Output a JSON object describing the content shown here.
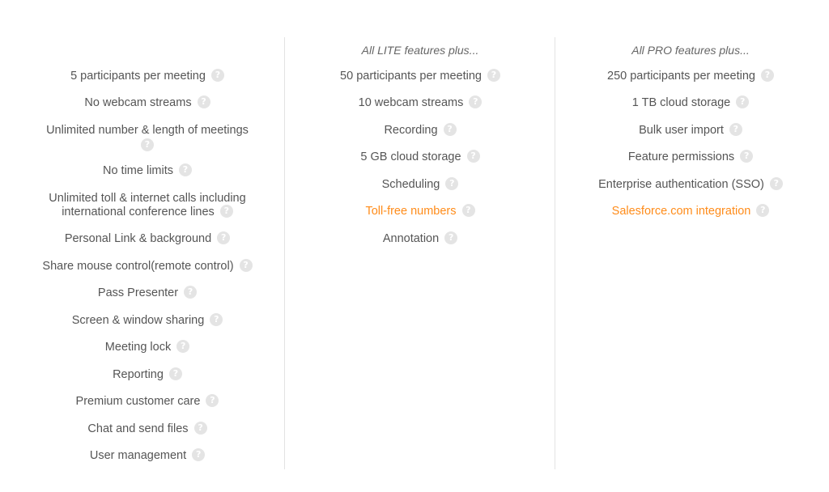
{
  "help_glyph": "?",
  "columns": [
    {
      "header": "",
      "features": [
        {
          "label": "5 participants per meeting"
        },
        {
          "label": "No webcam streams"
        },
        {
          "label": "Unlimited number & length of meetings"
        },
        {
          "label": "No time limits"
        },
        {
          "label": "Unlimited toll & internet calls including international conference lines"
        },
        {
          "label": "Personal Link & background"
        },
        {
          "label": "Share mouse control(remote control)"
        },
        {
          "label": "Pass Presenter"
        },
        {
          "label": "Screen & window sharing"
        },
        {
          "label": "Meeting lock"
        },
        {
          "label": "Reporting"
        },
        {
          "label": "Premium customer care"
        },
        {
          "label": "Chat and send files"
        },
        {
          "label": "User management"
        }
      ]
    },
    {
      "header": "All LITE features plus...",
      "features": [
        {
          "label": "50 participants per meeting"
        },
        {
          "label": "10 webcam streams"
        },
        {
          "label": "Recording"
        },
        {
          "label": "5 GB cloud storage"
        },
        {
          "label": "Scheduling"
        },
        {
          "label": "Toll-free numbers",
          "highlight": true
        },
        {
          "label": "Annotation"
        }
      ]
    },
    {
      "header": "All PRO features plus...",
      "features": [
        {
          "label": "250 participants per meeting"
        },
        {
          "label": "1 TB cloud storage"
        },
        {
          "label": "Bulk user import"
        },
        {
          "label": "Feature permissions"
        },
        {
          "label": "Enterprise authentication (SSO)"
        },
        {
          "label": "Salesforce.com integration",
          "highlight": true
        }
      ]
    }
  ],
  "colors": {
    "text": "#555555",
    "highlight": "#ff8c1a",
    "help_badge": "#e4e4e4",
    "divider": "#e3e3e3"
  }
}
